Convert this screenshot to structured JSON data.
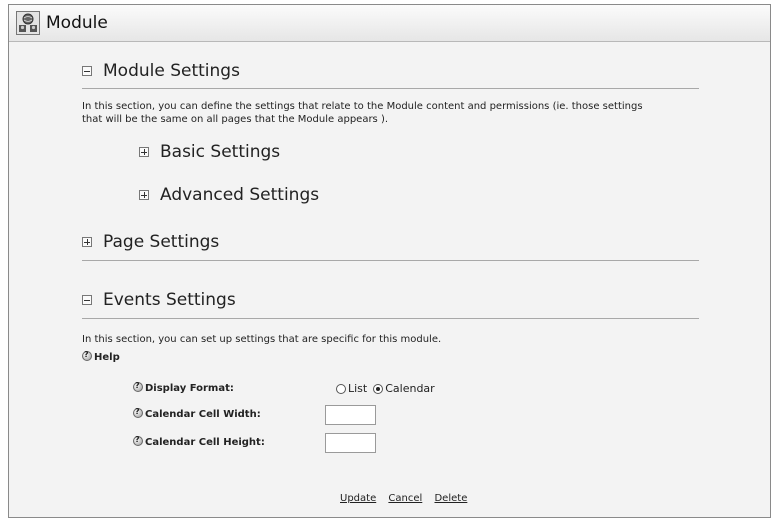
{
  "window": {
    "title": "Module",
    "icon": "module-globe-icon"
  },
  "sections": {
    "module_settings": {
      "title": "Module Settings",
      "expanded": true,
      "description_line1": "In this section, you can define the settings that relate to the Module content and permissions (ie. those settings",
      "description_line2": "that will be the same on all pages that the Module appears ).",
      "subsections": {
        "basic": {
          "title": "Basic Settings",
          "expanded": false
        },
        "advanced": {
          "title": "Advanced Settings",
          "expanded": false
        }
      }
    },
    "page_settings": {
      "title": "Page Settings",
      "expanded": false
    },
    "events_settings": {
      "title": "Events Settings",
      "expanded": true,
      "description": "In this section, you can set up settings that are specific for this module.",
      "help_label": "Help",
      "fields": {
        "display_format": {
          "label": "Display Format:",
          "options": [
            "List",
            "Calendar"
          ],
          "selected": "Calendar"
        },
        "cell_width": {
          "label": "Calendar Cell Width:",
          "value": ""
        },
        "cell_height": {
          "label": "Calendar Cell Height:",
          "value": ""
        }
      }
    }
  },
  "actions": {
    "update": "Update",
    "cancel": "Cancel",
    "delete": "Delete"
  },
  "icons": {
    "collapse": "minus-square-icon",
    "expand": "plus-square-icon",
    "help": "help-question-icon"
  }
}
